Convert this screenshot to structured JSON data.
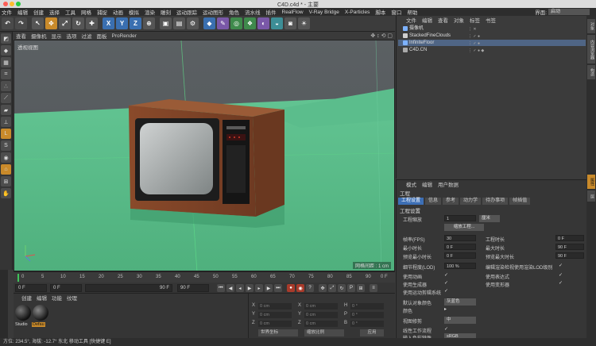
{
  "window": {
    "title": "C4D.c4d * - 主要"
  },
  "menubar": {
    "items": [
      "文件",
      "编辑",
      "创建",
      "选择",
      "工具",
      "网格",
      "捕捉",
      "动画",
      "模拟",
      "渲染",
      "雕刻",
      "运动跟踪",
      "运动图形",
      "角色",
      "流水线",
      "插件",
      "RealFlow",
      "V-Ray Bridge",
      "X-Particles",
      "脚本",
      "窗口",
      "帮助"
    ],
    "layout_label": "界面:",
    "layout_value": "启动"
  },
  "viewport": {
    "menu": [
      "查看",
      "摄像机",
      "显示",
      "选项",
      "过滤",
      "面板",
      "ProRender"
    ],
    "label": "透视视图",
    "grid_scale": "网格间距 : 1 cm"
  },
  "timeline": {
    "ticks": [
      "0",
      "5",
      "10",
      "15",
      "20",
      "25",
      "30",
      "35",
      "40",
      "45",
      "50",
      "55",
      "60",
      "65",
      "70",
      "75",
      "80",
      "85",
      "90"
    ],
    "end_marker": "0 F"
  },
  "transport": {
    "current_frame": "0 F",
    "start_frame": "0 F",
    "end_frame_a": "90 F",
    "end_frame_b": "90 F"
  },
  "material_manager": {
    "menu": [
      "创建",
      "编辑",
      "功能",
      "纹理"
    ],
    "materials": [
      {
        "name": "Studio",
        "color": "#1c1c1c"
      },
      {
        "name": "Defau",
        "color": "#2a2a2a"
      }
    ]
  },
  "coordinates": {
    "rows": [
      {
        "axis": "X",
        "pos": "0 cm",
        "axis2": "X",
        "size": "0 cm",
        "axis3": "H",
        "rot": "0 °"
      },
      {
        "axis": "Y",
        "pos": "0 cm",
        "axis2": "Y",
        "size": "0 cm",
        "axis3": "P",
        "rot": "0 °"
      },
      {
        "axis": "Z",
        "pos": "0 cm",
        "axis2": "Z",
        "size": "0 cm",
        "axis3": "B",
        "rot": "0 °"
      }
    ],
    "mode_a": "世界坐标",
    "mode_b": "缩放比例",
    "apply": "应用"
  },
  "object_manager": {
    "menu": [
      "文件",
      "编辑",
      "查看",
      "对象",
      "标签",
      "书签"
    ],
    "objects": [
      {
        "name": "摄像机",
        "icon": "camera-icon",
        "icon_color": "#7db2ff",
        "selected": false
      },
      {
        "name": "StackedFineClouds",
        "icon": "cloud-icon",
        "icon_color": "#cfcfcf",
        "selected": false
      },
      {
        "name": "InfiniteFloor",
        "icon": "floor-icon",
        "icon_color": "#7db2ff",
        "selected": true
      },
      {
        "name": "C4D.CN",
        "icon": "null-icon",
        "icon_color": "#aaaaaa",
        "selected": false
      }
    ]
  },
  "attribute_manager": {
    "menu": [
      "模式",
      "编辑",
      "用户数据"
    ],
    "title": "工程",
    "tabs": [
      "工程设置",
      "信息",
      "参考",
      "动力学",
      "待办事项",
      "帧插值"
    ],
    "section": "工程设置",
    "fields": {
      "scale_label": "工程缩放",
      "scale_value": "1",
      "scale_unit": "厘米",
      "scale_btn": "缩放工程...",
      "fps_label": "帧率(FPS)",
      "fps_value": "30",
      "duration_label": "工程时长",
      "duration_value": "0 F",
      "min_time_label": "最小时长",
      "min_time_value": "0 F",
      "max_time_label": "最大时长",
      "max_time_value": "90 F",
      "preview_min_label": "预览最小时长",
      "preview_min_value": "0 F",
      "preview_max_label": "预览最大时长",
      "preview_max_value": "90 F",
      "lod_label": "细节程度(LOD)",
      "lod_value": "100 %",
      "render_lod_label": "编辑渲染检视使用渲染LOD级别",
      "use_anim_label": "使用动画",
      "use_expr_label": "使用表达式",
      "use_gen_label": "使用生成器",
      "use_deform_label": "使用变形器",
      "use_motion_label": "使用运动剪辑系统",
      "default_color_label": "默认对象颜色",
      "default_color_value": "灰蓝色",
      "color_label": "颜色",
      "view_clip_label": "视图修剪",
      "view_clip_value": "中",
      "linear_label": "线性工作流程",
      "input_color_label": "输入色彩特性",
      "input_color_value": "sRGB"
    }
  },
  "right_tabs": [
    "对象",
    "内容浏览器",
    "构造",
    "属性",
    "层"
  ],
  "status": "方位: 234.5°, 海拔: -12.7° 东北   移动工具 [快捷键 E]"
}
